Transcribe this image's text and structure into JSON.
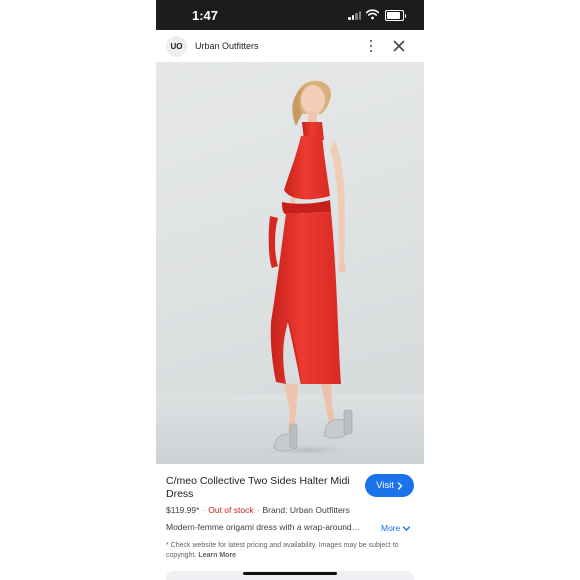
{
  "status_bar": {
    "time": "1:47",
    "battery_level": 0.85
  },
  "header": {
    "logo_text": "UO",
    "site_name": "Urban Outfitters"
  },
  "product": {
    "title": "C/meo Collective Two Sides Halter Midi Dress",
    "price": "$119.99*",
    "stock_status": "Out of stock",
    "brand": "Brand: Urban Outfitters",
    "description": "Modern-femme origami dress with a wrap-around…",
    "more_label": "More",
    "visit_label": "Visit",
    "disclaimer": "* Check website for latest pricing and availability. Images may be subject to copyright.",
    "learn_more_label": "Learn More"
  },
  "colors": {
    "accent": "#1a73e8",
    "out_of_stock": "#c5221f",
    "dress": "#e8332c"
  }
}
